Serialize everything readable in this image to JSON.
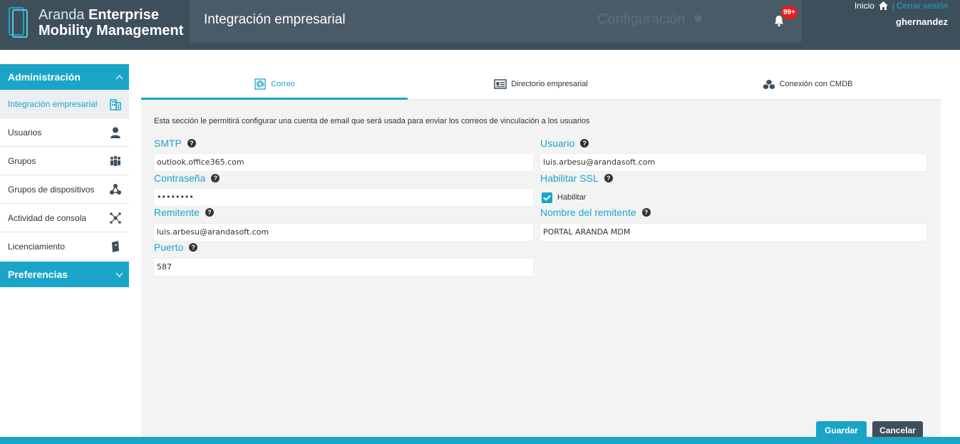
{
  "app": {
    "brand_light": "Aranda ",
    "brand_bold_1": "Enterprise",
    "brand_bold_2": "Mobility Management"
  },
  "header": {
    "title": "Integración empresarial",
    "config_label": "Configuración",
    "notification_badge": "99+",
    "inicio_label": "Inicio",
    "separator": "|",
    "logout_label": "Cerrar sesión",
    "username": "ghernandez"
  },
  "sidebar": {
    "admin_header": "Administración",
    "items": [
      {
        "label": "Integración empresarial",
        "icon": "building-icon",
        "active": true
      },
      {
        "label": "Usuarios",
        "icon": "user-icon",
        "active": false
      },
      {
        "label": "Grupos",
        "icon": "group-icon",
        "active": false
      },
      {
        "label": "Grupos de dispositivos",
        "icon": "device-group-icon",
        "active": false
      },
      {
        "label": "Actividad de consola",
        "icon": "activity-network-icon",
        "active": false
      },
      {
        "label": "Licenciamiento",
        "icon": "license-book-icon",
        "active": false
      }
    ],
    "preferences_header": "Preferencias"
  },
  "tabs": [
    {
      "label": "Correo",
      "icon": "at-sign-icon",
      "active": true
    },
    {
      "label": "Directorio empresarial",
      "icon": "directory-icon",
      "active": false
    },
    {
      "label": "Conexión con CMDB",
      "icon": "cubes-icon",
      "active": false
    }
  ],
  "form": {
    "description": "Esta sección le permitirá configurar una cuenta de email que será usada para enviar los correos de vinculación a los usuarios",
    "smtp": {
      "label": "SMTP",
      "value": "outlook.office365.com"
    },
    "usuario": {
      "label": "Usuario",
      "value": "luis.arbesu@arandasoft.com"
    },
    "password": {
      "label": "Contraseña",
      "value": "••••••••"
    },
    "ssl": {
      "label": "Habilitar SSL",
      "checkbox_label": "Habilitar",
      "checked": true
    },
    "remitente": {
      "label": "Remitente",
      "value": "luis.arbesu@arandasoft.com"
    },
    "nombre_remitente": {
      "label": "Nombre del remitente",
      "value": "PORTAL ARANDA MDM"
    },
    "puerto": {
      "label": "Puerto",
      "value": "587"
    },
    "help_glyph": "?"
  },
  "buttons": {
    "save": "Guardar",
    "cancel": "Cancelar"
  },
  "colors": {
    "accent": "#1aa5c8",
    "header": "#3e4f5c",
    "badge": "#e02020"
  }
}
